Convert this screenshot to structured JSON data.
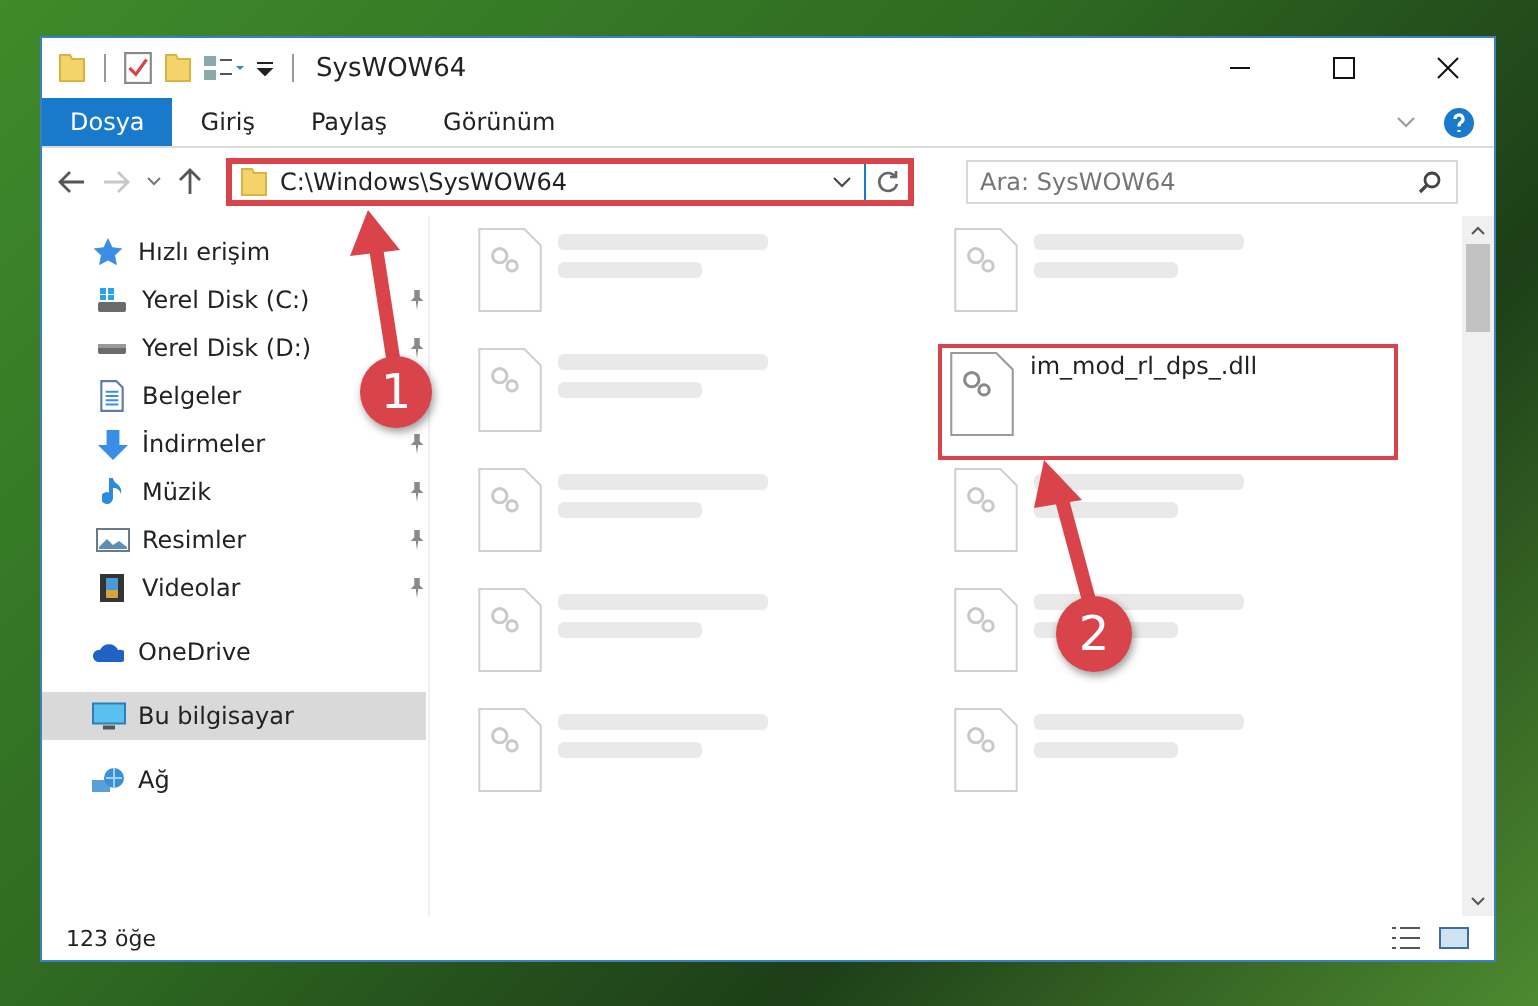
{
  "window": {
    "title": "SysWOW64"
  },
  "ribbon_tabs": [
    {
      "label": "Dosya",
      "selected": true
    },
    {
      "label": "Giriş",
      "selected": false
    },
    {
      "label": "Paylaş",
      "selected": false
    },
    {
      "label": "Görünüm",
      "selected": false
    }
  ],
  "navigation": {
    "forward_disabled": true
  },
  "address_bar": {
    "value": "C:\\Windows\\SysWOW64",
    "highlighted": true
  },
  "search": {
    "placeholder": "Ara: SysWOW64"
  },
  "sidebar": {
    "items": [
      {
        "label": "Hızlı erişim",
        "kind": "star",
        "selected": false,
        "children": [
          {
            "label": "Yerel Disk (C:)",
            "kind": "drive-win",
            "pinned": true,
            "selected": false
          },
          {
            "label": "Yerel Disk (D:)",
            "kind": "drive",
            "pinned": true,
            "selected": false
          },
          {
            "label": "Belgeler",
            "kind": "document",
            "selected": false
          },
          {
            "label": "İndirmeler",
            "kind": "download",
            "pinned": true,
            "selected": false
          },
          {
            "label": "Müzik",
            "kind": "music",
            "pinned": true,
            "selected": false
          },
          {
            "label": "Resimler",
            "kind": "picture",
            "pinned": true,
            "selected": false
          },
          {
            "label": "Videolar",
            "kind": "video",
            "pinned": true,
            "selected": false
          }
        ]
      },
      {
        "label": "OneDrive",
        "kind": "cloud",
        "selected": false
      },
      {
        "label": "Bu bilgisayar",
        "kind": "computer",
        "selected": true
      },
      {
        "label": "Ağ",
        "kind": "network",
        "selected": false
      }
    ]
  },
  "files": [
    {
      "kind": "blurred"
    },
    {
      "kind": "blurred"
    },
    {
      "kind": "blurred"
    },
    {
      "kind": "file",
      "name": "im_mod_rl_dps_.dll",
      "highlighted": true
    },
    {
      "kind": "blurred"
    },
    {
      "kind": "blurred"
    },
    {
      "kind": "blurred"
    },
    {
      "kind": "blurred"
    },
    {
      "kind": "blurred"
    },
    {
      "kind": "blurred"
    }
  ],
  "callouts": [
    "1",
    "2"
  ],
  "status_bar": {
    "item_count": "123 öğe"
  }
}
